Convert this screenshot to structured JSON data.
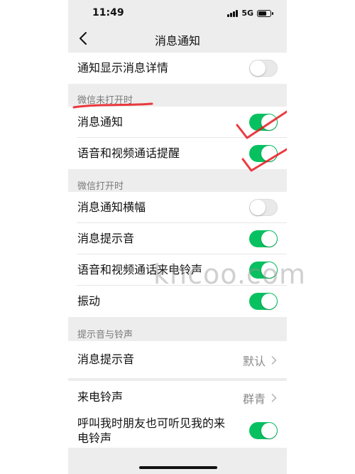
{
  "status_bar": {
    "time": "11:49",
    "network": "5G"
  },
  "nav": {
    "title": "消息通知"
  },
  "rows": {
    "show_details": {
      "label": "通知显示消息详情",
      "toggle": "off"
    },
    "wechat_closed_header": "微信未打开时",
    "closed_message_notify": {
      "label": "消息通知",
      "toggle": "on"
    },
    "closed_voice_video": {
      "label": "语音和视频通话提醒",
      "toggle": "on"
    },
    "wechat_open_header": "微信打开时",
    "open_banner": {
      "label": "消息通知横幅",
      "toggle": "off"
    },
    "open_sound": {
      "label": "消息提示音",
      "toggle": "on"
    },
    "open_voice_video_ringtone": {
      "label": "语音和视频通话来电铃声",
      "toggle": "on"
    },
    "open_vibrate": {
      "label": "振动",
      "toggle": "on"
    },
    "sounds_header": "提示音与铃声",
    "msg_sound": {
      "label": "消息提示音",
      "value": "默认"
    },
    "ringtone": {
      "label": "来电铃声",
      "value": "群青"
    },
    "friends_hear": {
      "label_line1": "呼叫我时朋友也可听见我的来",
      "label_line2": "电铃声",
      "toggle": "on"
    }
  },
  "watermark": "khcoo.com",
  "colors": {
    "toggle_on": "#07c160",
    "toggle_off": "#e9e9e9",
    "annotation_red": "#e8191e",
    "background": "#ededed"
  }
}
